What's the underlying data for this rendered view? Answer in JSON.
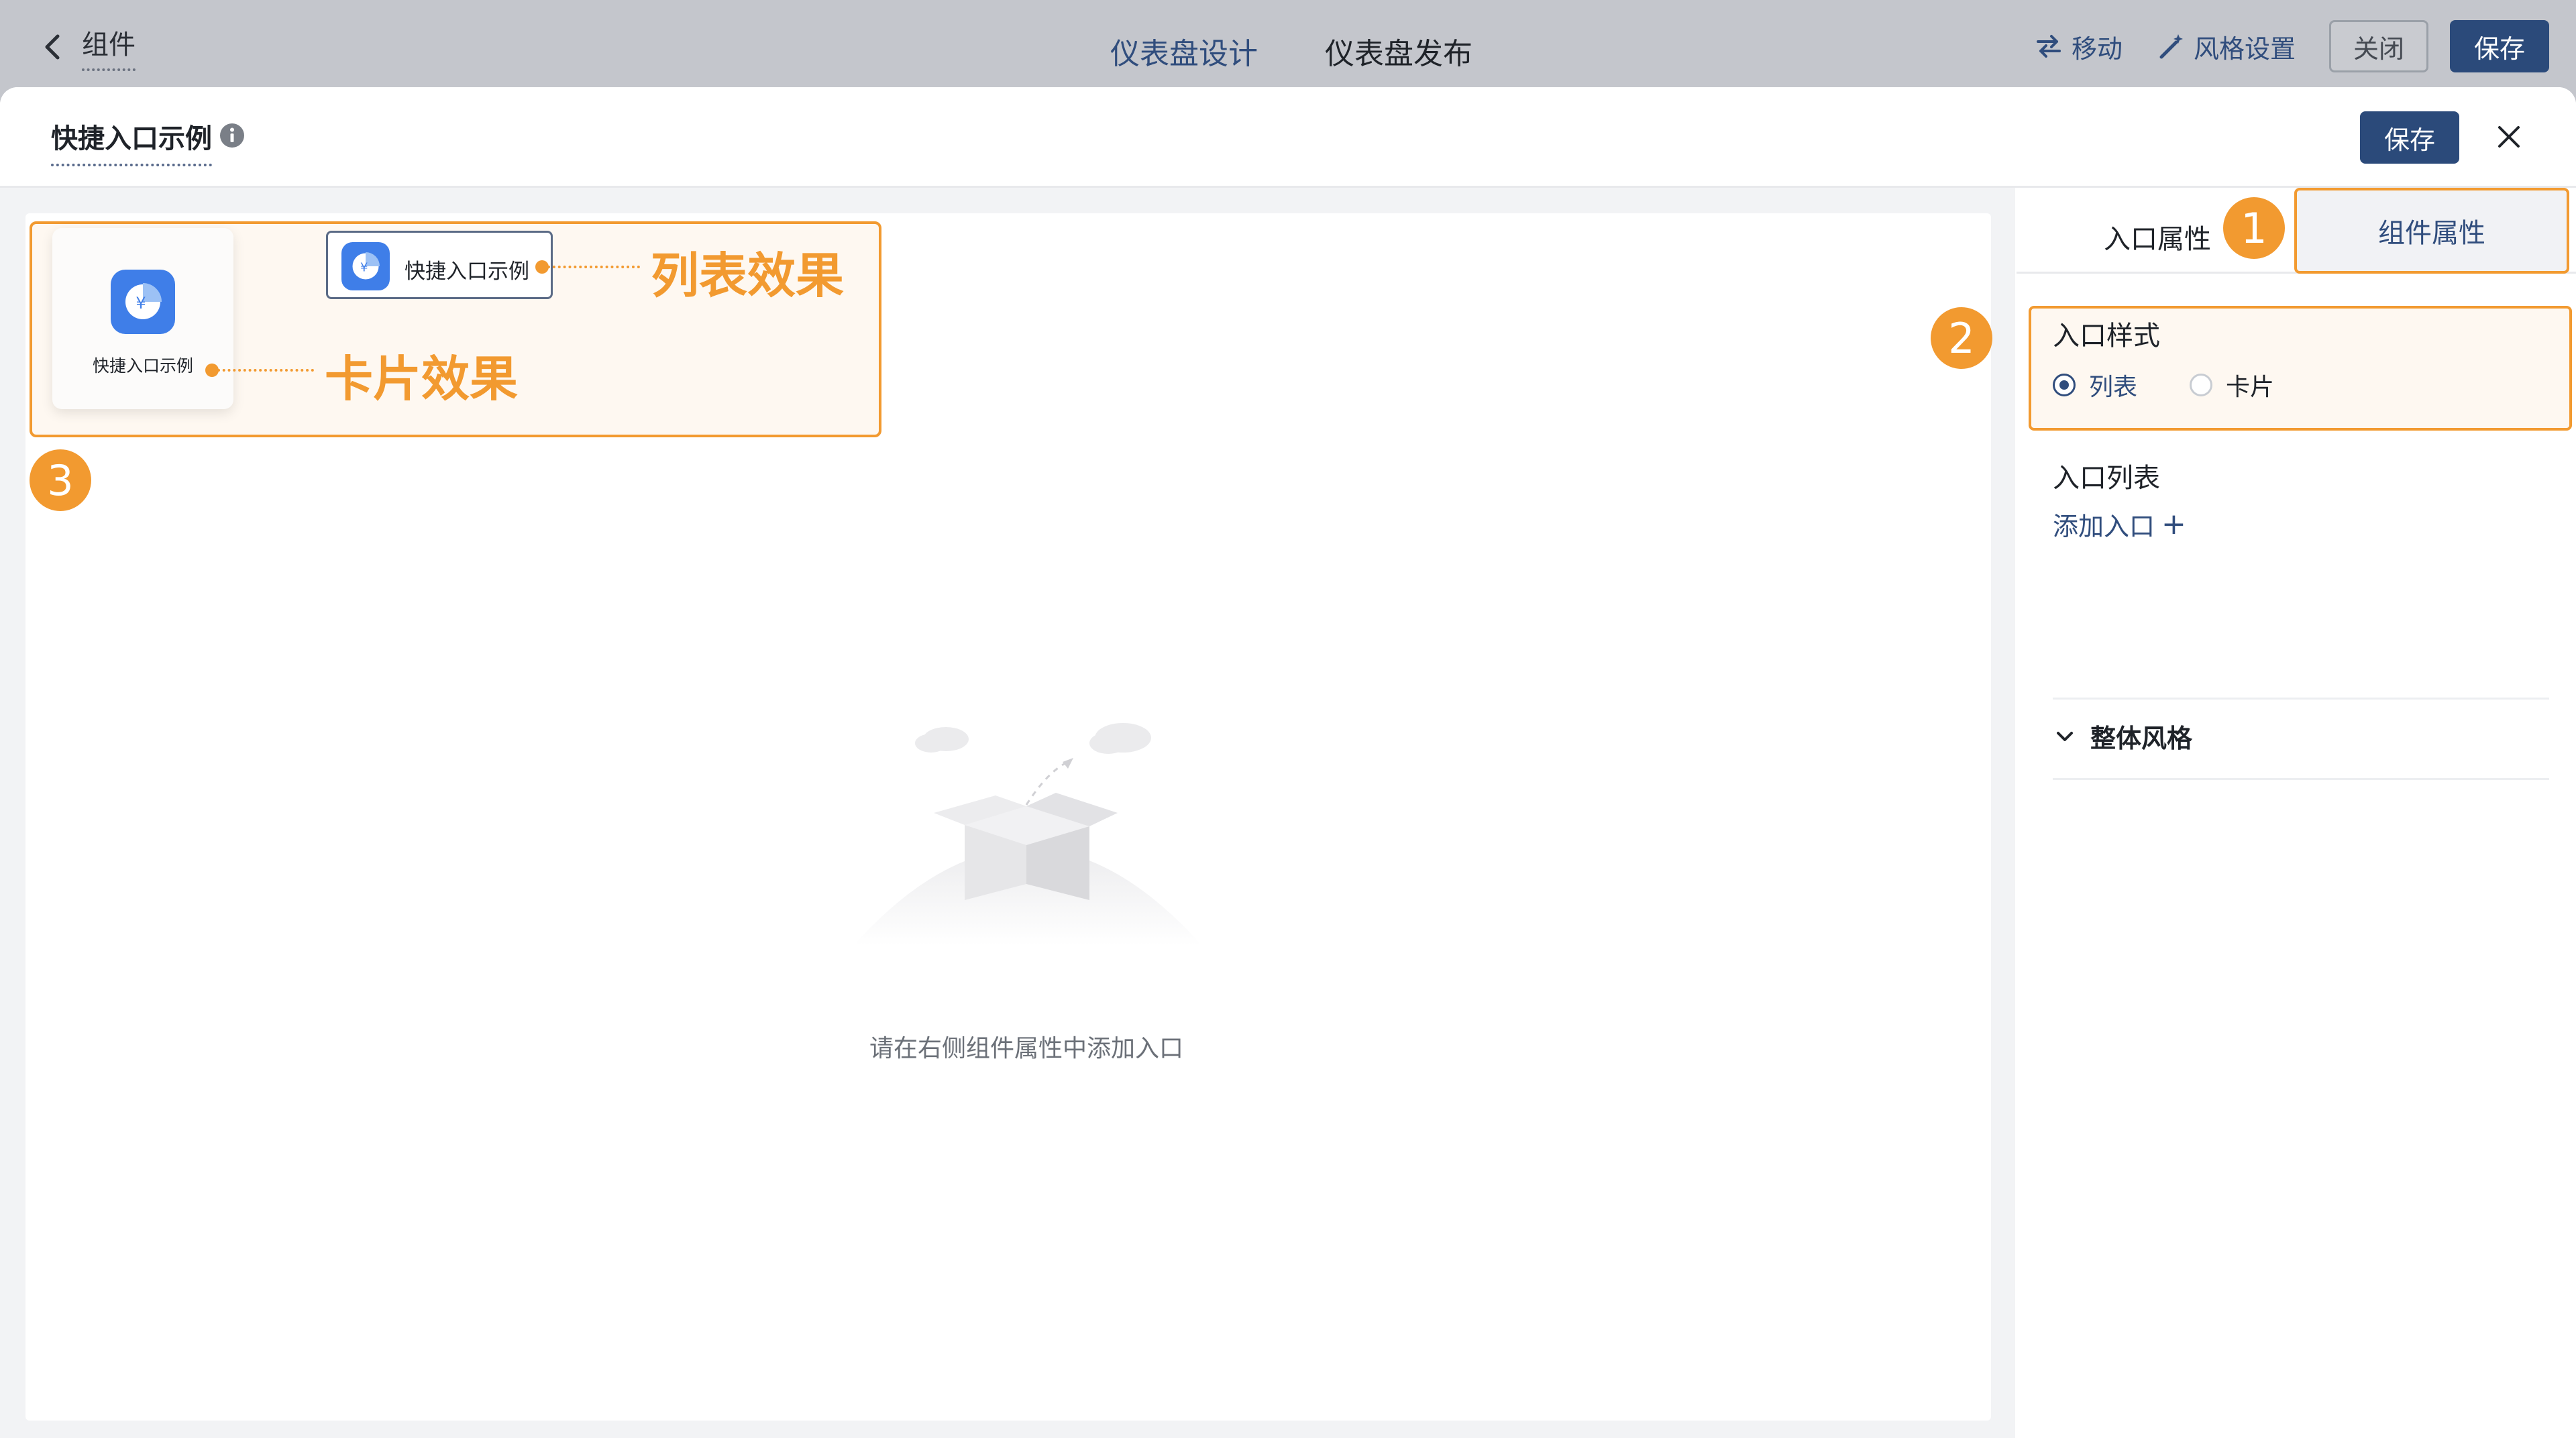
{
  "top_bar": {
    "back_label": "组件",
    "tabs": [
      {
        "label": "仪表盘设计"
      },
      {
        "label": "仪表盘发布"
      }
    ],
    "move_label": "移动",
    "style_label": "风格设置",
    "close_label": "关闭",
    "save_label": "保存"
  },
  "modal": {
    "title": "快捷入口示例",
    "save_label": "保存"
  },
  "canvas": {
    "card_demo_label": "快捷入口示例",
    "list_demo_label": "快捷入口示例",
    "annotation_list": "列表效果",
    "annotation_card": "卡片效果",
    "badge_3": "3",
    "empty_text": "请在右侧组件属性中添加入口"
  },
  "panel": {
    "tabs": [
      {
        "label": "入口属性"
      },
      {
        "label": "组件属性"
      }
    ],
    "badge_1": "1",
    "badge_2": "2",
    "entry_style_label": "入口样式",
    "radio_options": [
      {
        "label": "列表",
        "checked": true
      },
      {
        "label": "卡片",
        "checked": false
      }
    ],
    "entry_list_label": "入口列表",
    "add_entry_label": "添加入口",
    "add_entry_symbol": "+",
    "overall_style_label": "整体风格"
  },
  "colors": {
    "primary": "#2b4a7a",
    "link": "#304d7d",
    "annotation": "#f29a30",
    "app_icon": "#3f7ee8"
  },
  "icons": {
    "back": "chevron-left-icon",
    "move": "swap-arrows-icon",
    "style": "magic-wand-icon",
    "info": "info-icon",
    "close": "close-icon",
    "app": "yen-pie-chart-icon",
    "collapse": "chevron-down-icon"
  }
}
